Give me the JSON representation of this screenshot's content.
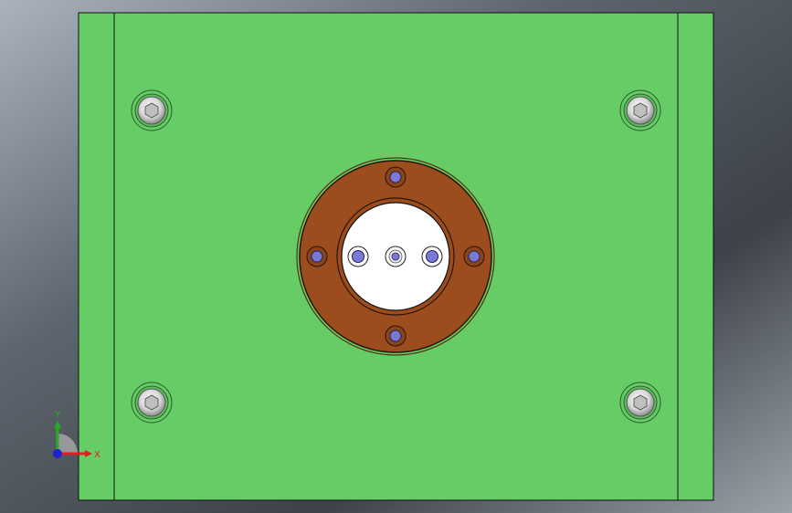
{
  "viewport": {
    "background_colors": [
      "#9aa3ad",
      "#5f6770",
      "#3c4046",
      "#8a9199"
    ]
  },
  "plate": {
    "color": "#66cd66",
    "edge_color": "#111111"
  },
  "fixing_screws": {
    "count": 4,
    "icon": "socket-head-screw-icon"
  },
  "locating_ring": {
    "color": "#9c4d1e",
    "bolt_count": 4,
    "hole_color": "#7a7ad6"
  },
  "sprue_bushing": {
    "color": "#ffffff",
    "hole_count": 3
  },
  "triad": {
    "x_label": "X",
    "y_label": "Y",
    "x_color": "#e02020",
    "y_color": "#20b020",
    "z_color": "#2020d0"
  }
}
